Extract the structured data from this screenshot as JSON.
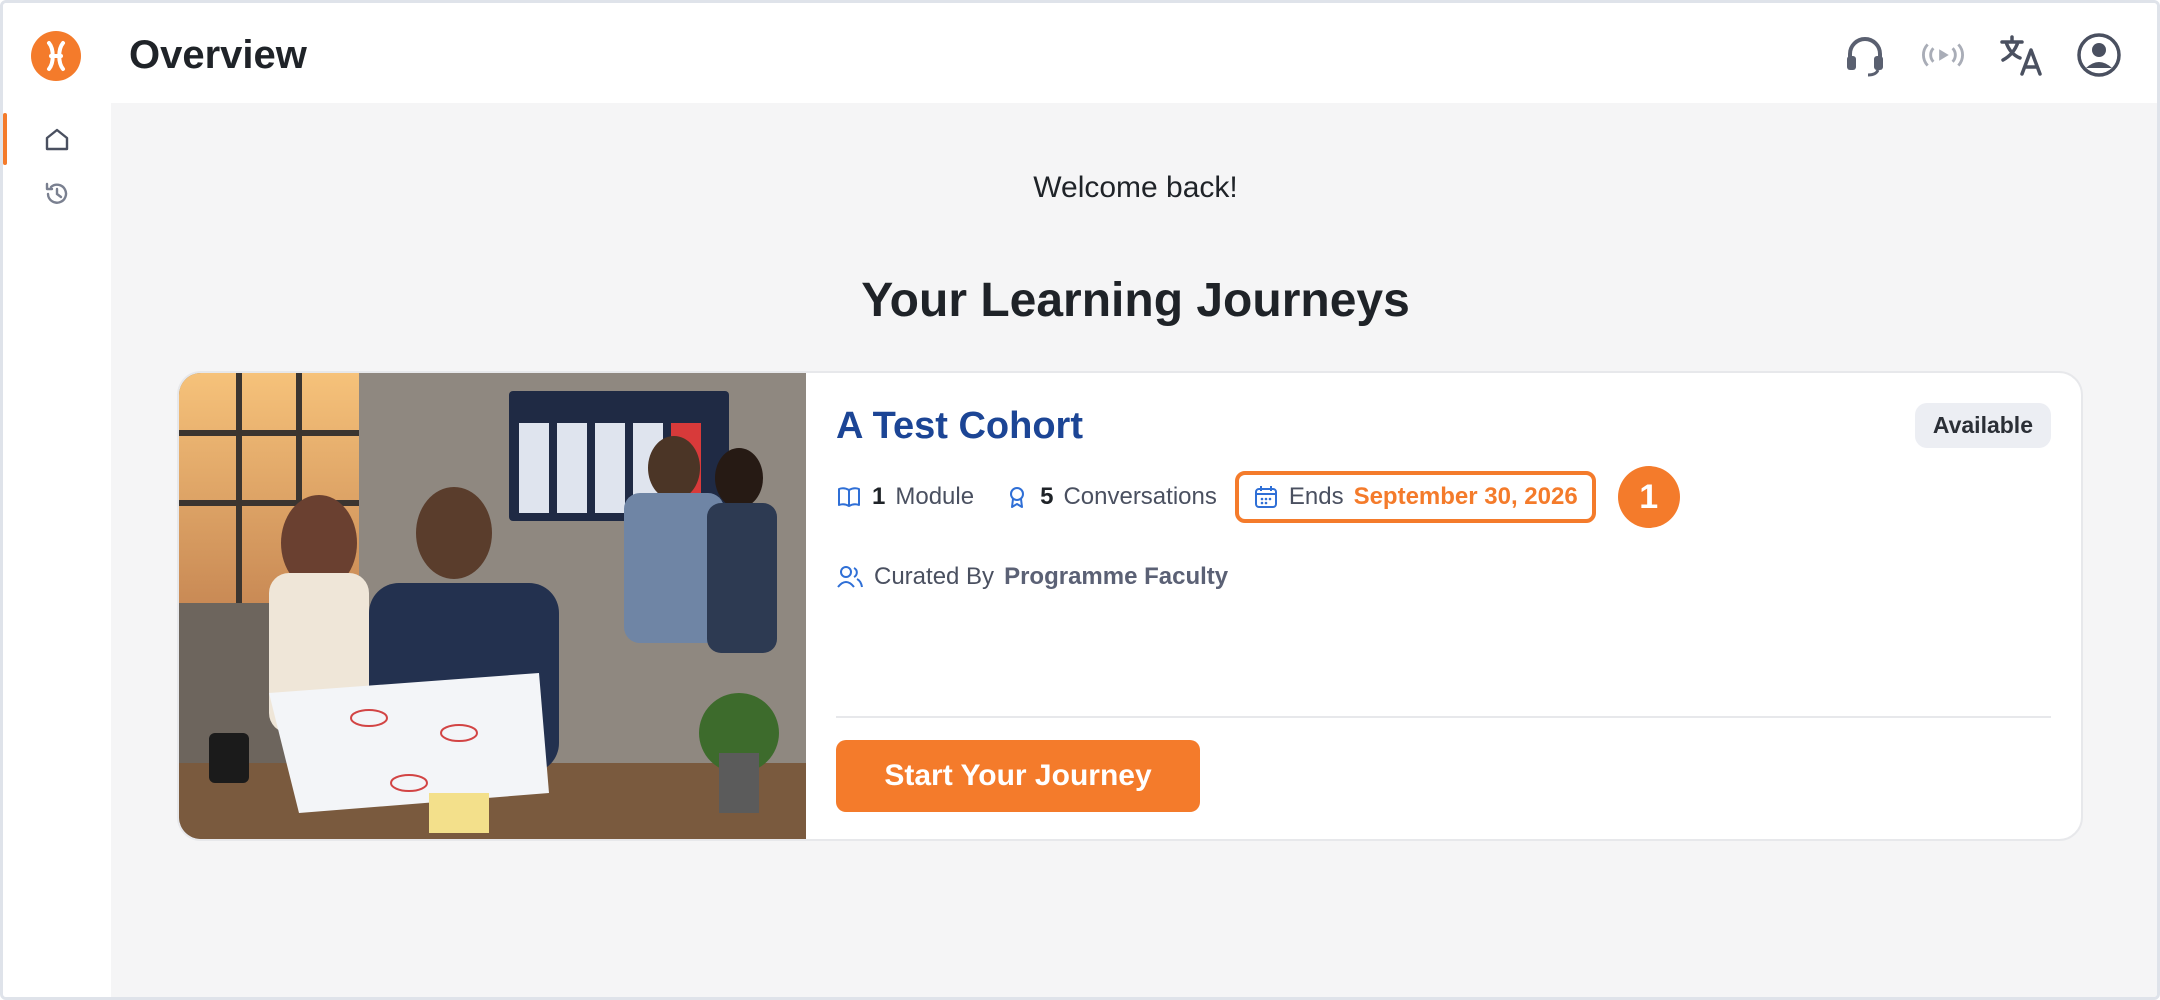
{
  "app": {
    "page_title": "Overview"
  },
  "header": {
    "icons": [
      "headset-icon",
      "broadcast-icon",
      "translate-icon",
      "account-icon"
    ]
  },
  "sidebar": {
    "items": [
      {
        "icon": "home-icon",
        "active": true
      },
      {
        "icon": "history-icon",
        "active": false
      }
    ]
  },
  "main": {
    "welcome": "Welcome back!",
    "section_title": "Your Learning Journeys"
  },
  "card": {
    "title": "A Test Cohort",
    "status_badge": "Available",
    "modules_count": "1",
    "modules_label": "Module",
    "conversations_count": "5",
    "conversations_label": "Conversations",
    "ends_label": "Ends",
    "ends_date": "September 30, 2026",
    "step_marker": "1",
    "curated_label": "Curated By",
    "curated_by": "Programme Faculty",
    "cta_label": "Start Your Journey"
  },
  "colors": {
    "accent": "#f47b2b",
    "title_blue": "#1c4595",
    "background": "#f5f5f6"
  }
}
